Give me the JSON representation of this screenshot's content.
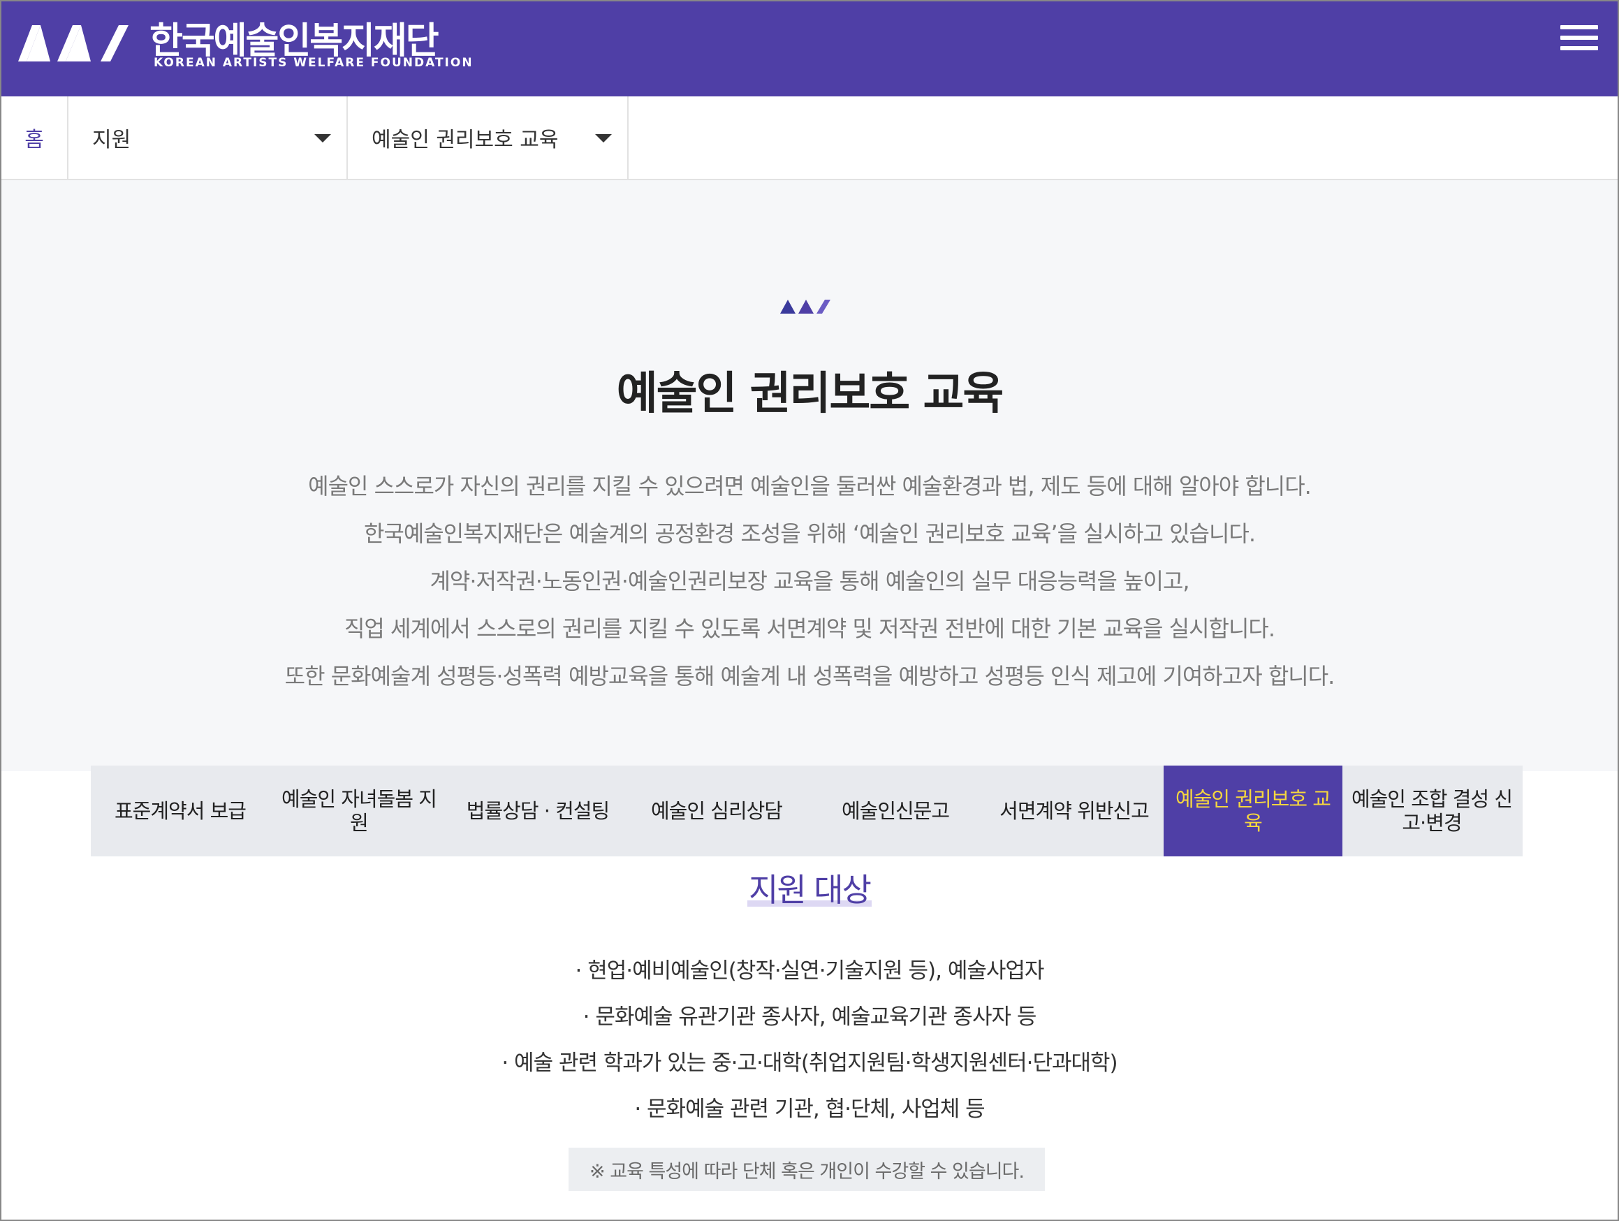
{
  "header": {
    "logo_name": "한국예술인복지재단",
    "logo_sub": "KOREAN ARTISTS WELFARE FOUNDATION",
    "menu_icon": "hamburger-menu-icon",
    "brand_color": "#4f3fa6"
  },
  "breadcrumb": {
    "home": "홈",
    "level1": "지원",
    "level2": "예술인 권리보호 교육"
  },
  "intro": {
    "title": "예술인 권리보호 교육",
    "paragraphs": [
      "예술인 스스로가 자신의 권리를 지킬 수 있으려면 예술인을 둘러싼 예술환경과 법, 제도 등에 대해 알아야 합니다.",
      "한국예술인복지재단은 예술계의 공정환경 조성을 위해 ‘예술인 권리보호 교육’을 실시하고 있습니다.",
      "계약·저작권·노동인권·예술인권리보장 교육을 통해 예술인의 실무 대응능력을 높이고,",
      "직업 세계에서 스스로의 권리를 지킬 수 있도록 서면계약 및 저작권 전반에 대한 기본 교육을 실시합니다.",
      "또한 문화예술계 성평등·성폭력 예방교육을 통해 예술계 내 성폭력을 예방하고 성평등 인식 제고에 기여하고자 합니다."
    ]
  },
  "tabs": [
    {
      "label": "표준계약서 보급"
    },
    {
      "label": "예술인 자녀돌봄 지원"
    },
    {
      "label": "법률상담 · 컨설팅"
    },
    {
      "label": "예술인 심리상담"
    },
    {
      "label": "예술인신문고"
    },
    {
      "label": "서면계약 위반신고"
    },
    {
      "label": "예술인 권리보호 교육"
    },
    {
      "label": "예술인 조합 결성 신고·변경"
    }
  ],
  "active_tab_color": "#f5d63f",
  "support": {
    "title": "지원 대상",
    "items": [
      "· 현업·예비예술인(창작·실연·기술지원 등), 예술사업자",
      "· 문화예술 유관기관 종사자, 예술교육기관 종사자 등",
      "· 예술 관련 학과가 있는 중·고·대학(취업지원팀·학생지원센터·단과대학)",
      "· 문화예술 관련 기관, 협·단체, 사업체 등"
    ],
    "note": "※ 교육 특성에 따라 단체 혹은 개인이 수강할 수 있습니다."
  }
}
